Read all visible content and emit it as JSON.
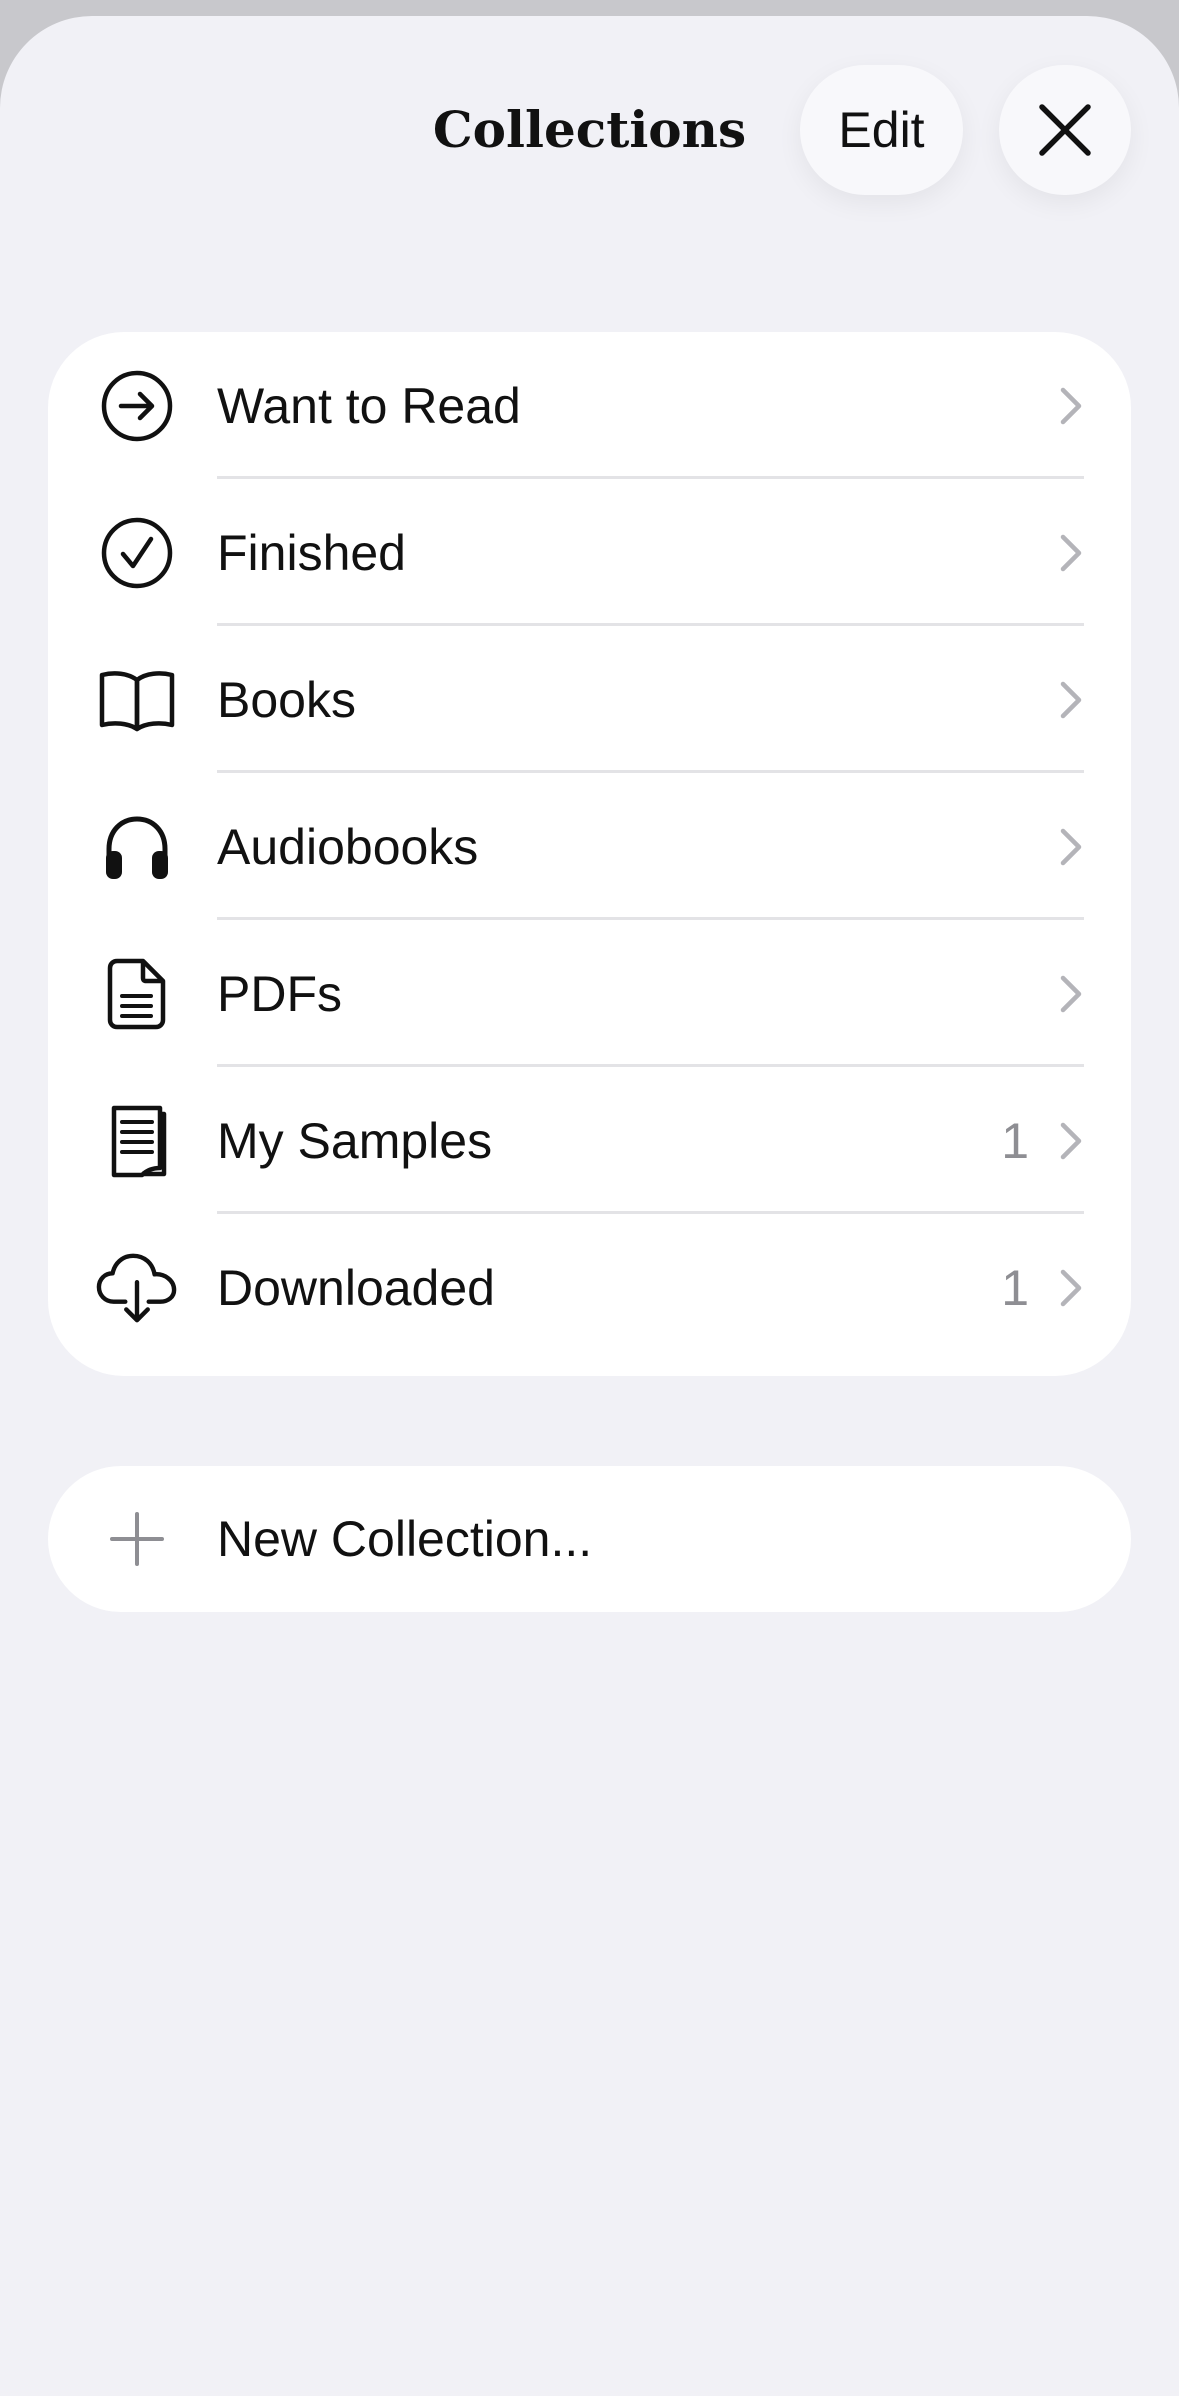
{
  "header": {
    "title": "Collections",
    "edit_label": "Edit",
    "close_icon": "close-icon"
  },
  "collections": [
    {
      "label": "Want to Read",
      "icon": "arrow-circle-right-icon",
      "count": ""
    },
    {
      "label": "Finished",
      "icon": "checkmark-circle-icon",
      "count": ""
    },
    {
      "label": "Books",
      "icon": "open-book-icon",
      "count": ""
    },
    {
      "label": "Audiobooks",
      "icon": "headphones-icon",
      "count": ""
    },
    {
      "label": "PDFs",
      "icon": "document-icon",
      "count": ""
    },
    {
      "label": "My Samples",
      "icon": "sample-book-icon",
      "count": "1"
    },
    {
      "label": "Downloaded",
      "icon": "cloud-download-icon",
      "count": "1"
    }
  ],
  "new_collection": {
    "label": "New Collection...",
    "icon": "plus-icon"
  },
  "colors": {
    "background": "#f1f1f6",
    "card": "#ffffff",
    "text": "#111111",
    "secondary": "#8e8e93",
    "chevron": "#b4b4b9"
  }
}
